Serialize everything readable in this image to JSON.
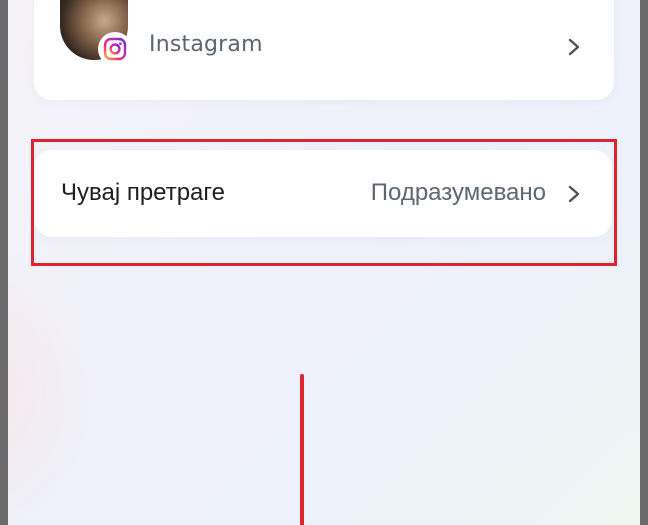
{
  "accounts": {
    "instagram": {
      "label": "Instagram",
      "badge_icon": "instagram-icon",
      "chevron_icon": "chevron-right-icon"
    }
  },
  "settings": {
    "save_searches": {
      "label": "Чувај претраге",
      "value": "Подразумевано",
      "chevron_icon": "chevron-right-icon"
    }
  },
  "colors": {
    "highlight": "#e0242f",
    "title_text": "#1b1f24",
    "secondary_text": "#5d6673",
    "card_background": "#ffffff"
  }
}
